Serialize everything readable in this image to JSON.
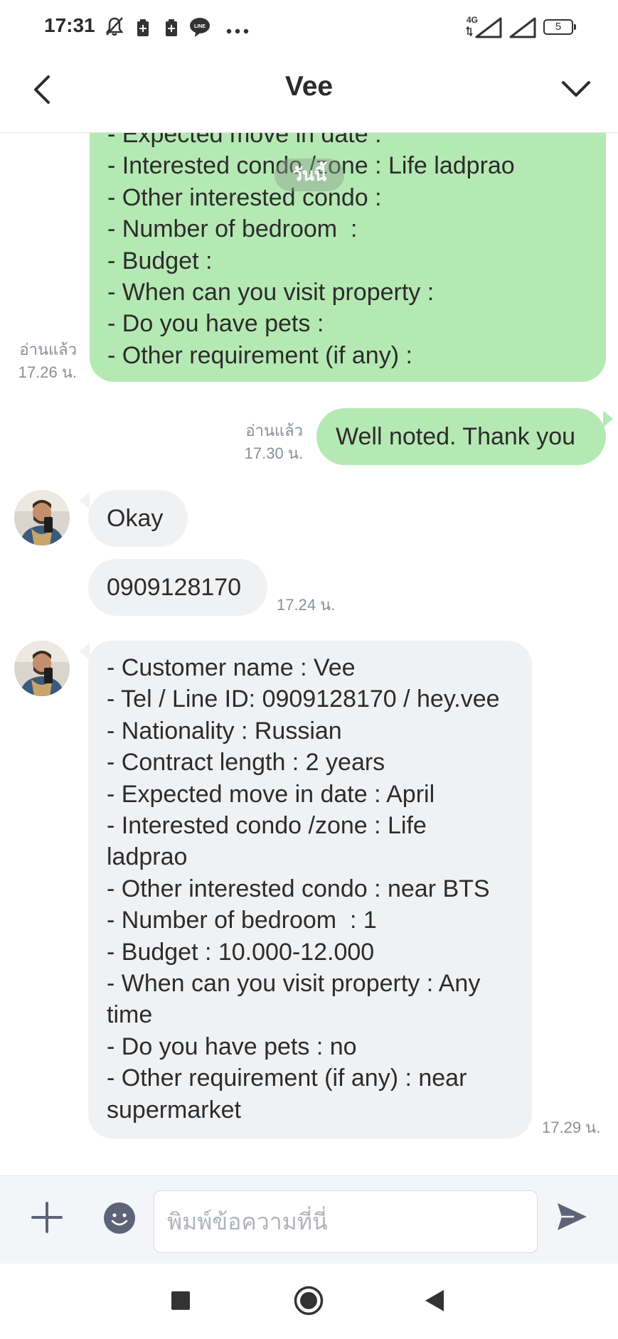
{
  "status_bar": {
    "time": "17:31",
    "network_label": "4G",
    "battery_level": "5",
    "icons": [
      "mute-bell-icon",
      "battery-saver-icon",
      "battery-saver-icon",
      "line-app-icon",
      "more-dots-icon",
      "signal-icon",
      "signal-icon",
      "battery-icon"
    ]
  },
  "header": {
    "title": "Vee",
    "back_icon": "chevron-left-icon",
    "collapse_icon": "chevron-down-icon"
  },
  "date_chip": "วันนี้",
  "messages": [
    {
      "id": "sent-form",
      "direction": "sent",
      "lines": [
        "- Expected move in date :",
        "- Interested condo /zone : Life ladprao",
        "- Other interested condo :",
        "- Number of bedroom  :",
        "- Budget :",
        "- When can you visit property :",
        "- Do you have pets :",
        "- Other requirement (if any) :"
      ],
      "read_label": "อ่านแล้ว",
      "time": "17.26 น."
    },
    {
      "id": "sent-thanks",
      "direction": "sent",
      "lines": [
        "Well noted. Thank you"
      ],
      "read_label": "อ่านแล้ว",
      "time": "17.30 น."
    },
    {
      "id": "recv-okay",
      "direction": "received",
      "lines": [
        "Okay"
      ]
    },
    {
      "id": "recv-phone",
      "direction": "received",
      "lines": [
        "0909128170"
      ],
      "time": "17.24 น."
    },
    {
      "id": "recv-details",
      "direction": "received",
      "lines": [
        "- Customer name : Vee",
        "- Tel / Line ID: 0909128170 / hey.vee",
        "- Nationality : Russian",
        "- Contract length : 2 years",
        "- Expected move in date : April",
        "- Interested condo /zone : Life",
        "ladprao",
        "- Other interested condo : near BTS",
        "- Number of bedroom  : 1",
        "- Budget : 10.000-12.000",
        "- When can you visit property : Any",
        "time",
        "- Do you have pets : no",
        "- Other requirement (if any) : near",
        "supermarket"
      ],
      "time": "17.29 น."
    }
  ],
  "input_bar": {
    "placeholder": "พิมพ์ข้อความที่นี่",
    "plus_icon": "plus-icon",
    "emoji_icon": "emoji-icon",
    "send_icon": "send-icon"
  },
  "nav_bar": {
    "icons": [
      "recents-square-icon",
      "home-circle-icon",
      "back-triangle-icon"
    ]
  },
  "colors": {
    "sent_bubble": "#b5e9b3",
    "received_bubble": "#f0f1f3",
    "meta_text": "#8a8f96",
    "icon_gray": "#5d6478"
  }
}
